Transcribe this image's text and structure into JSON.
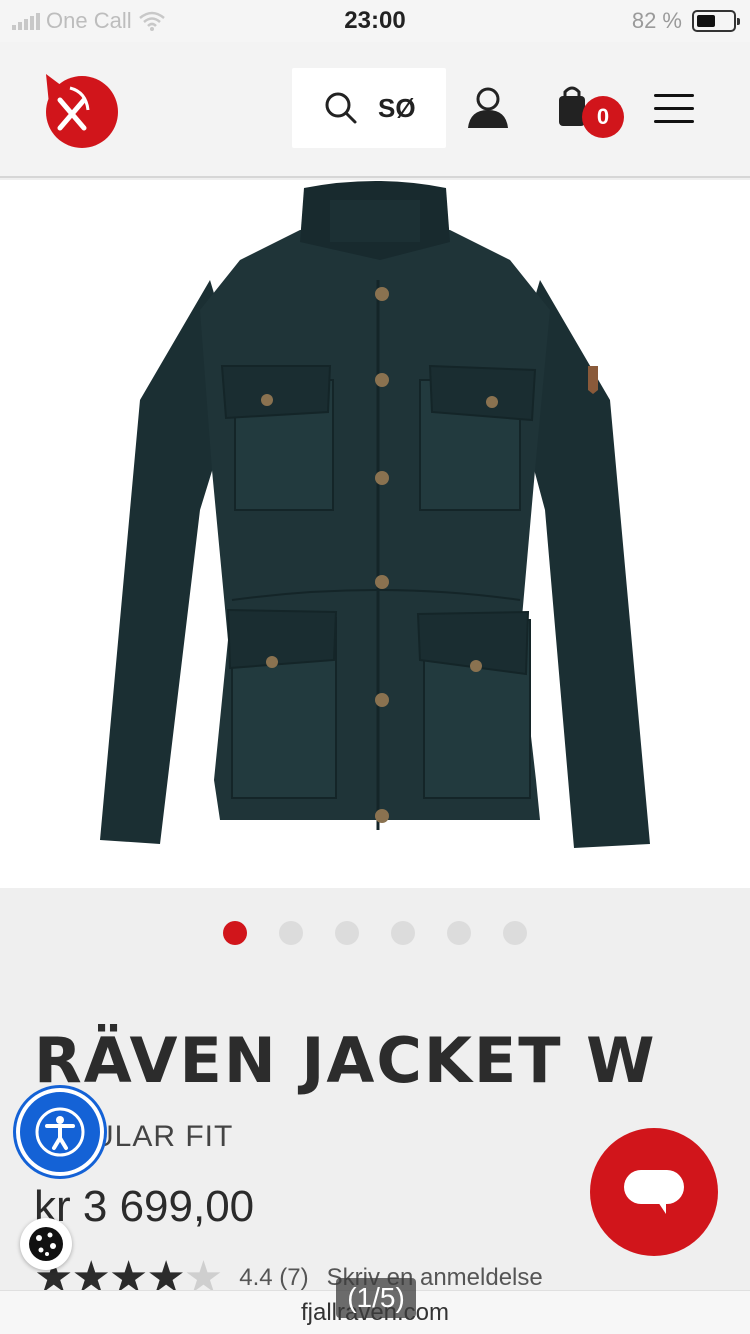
{
  "status_bar": {
    "carrier": "One Call",
    "time": "23:00",
    "battery": "82 %"
  },
  "header": {
    "search_label": "SØ",
    "cart_count": "0",
    "icons": [
      "fox-logo-icon",
      "search-icon",
      "account-icon",
      "cart-icon",
      "menu-icon"
    ]
  },
  "carousel": {
    "total": 6,
    "active_index": 0
  },
  "product": {
    "title": "RÄVEN JACKET W",
    "fit": "ULAR FIT",
    "price": "kr 3 699,00",
    "rating": 4.4,
    "rating_text": "4.4 (7)",
    "review_link": "Skriv en anmeldelse"
  },
  "browser": {
    "url": "fjallraven.com",
    "image_counter": "(1/5)"
  },
  "colors": {
    "brand_red": "#d1151b",
    "accessibility_blue": "#1462d6",
    "jacket": "#1f3438"
  }
}
